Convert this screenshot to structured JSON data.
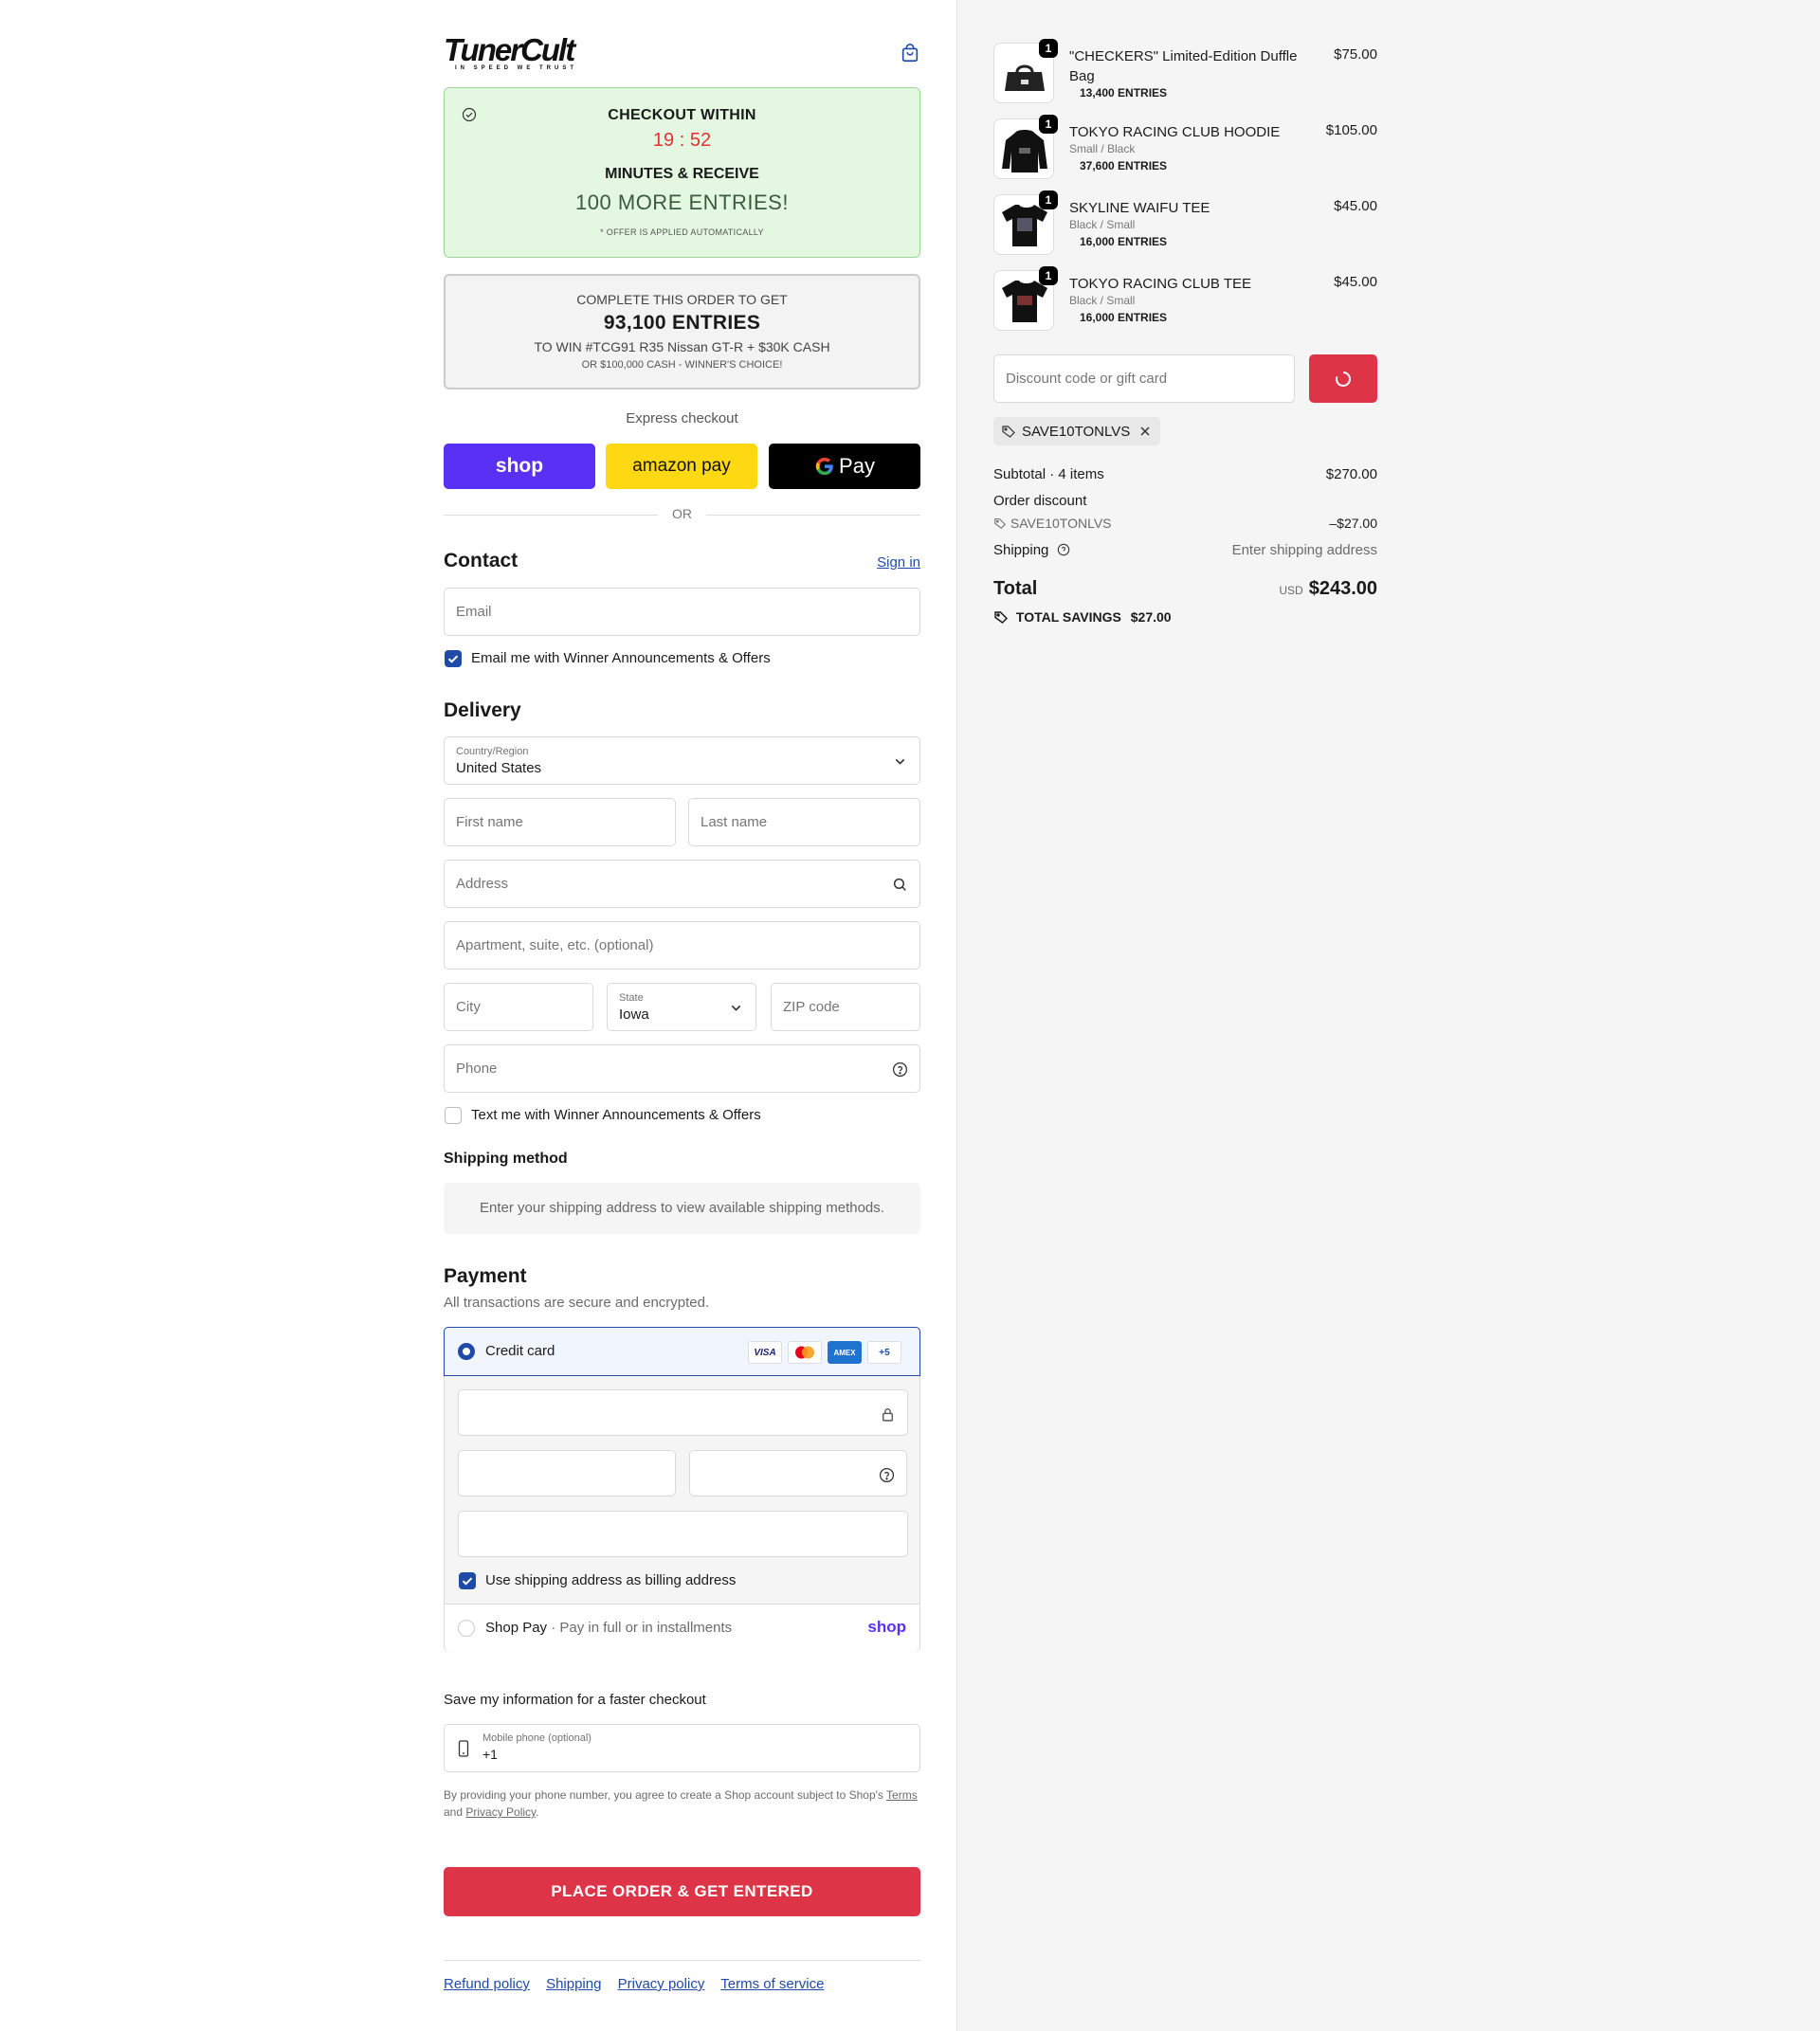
{
  "brand": {
    "name": "TunerCult",
    "tagline": "IN SPEED WE TRUST"
  },
  "promo": {
    "line1": "CHECKOUT WITHIN",
    "timer": "19 : 52",
    "line2": "MINUTES & RECEIVE",
    "line3": "100 MORE ENTRIES!",
    "note": "* OFFER IS APPLIED AUTOMATICALLY"
  },
  "entries_box": {
    "line1": "COMPLETE THIS ORDER TO GET",
    "line2": "93,100 ENTRIES",
    "line3": "TO WIN #TCG91 R35 Nissan GT-R + $30K CASH",
    "line4": "OR $100,000 CASH - WINNER'S CHOICE!"
  },
  "express": {
    "label": "Express checkout",
    "shop": "shop",
    "amazon": "amazon pay",
    "gpay": "Pay",
    "or": "OR"
  },
  "contact": {
    "title": "Contact",
    "sign_in": "Sign in",
    "email_placeholder": "Email",
    "email_optin": "Email me with Winner Announcements & Offers"
  },
  "delivery": {
    "title": "Delivery",
    "country_label": "Country/Region",
    "country_value": "United States",
    "first_name": "First name",
    "last_name": "Last name",
    "address": "Address",
    "apartment": "Apartment, suite, etc. (optional)",
    "city": "City",
    "state_label": "State",
    "state_value": "Iowa",
    "zip": "ZIP code",
    "phone": "Phone",
    "sms_optin": "Text me with Winner Announcements & Offers"
  },
  "shipping_method": {
    "title": "Shipping method",
    "info": "Enter your shipping address to view available shipping methods."
  },
  "payment": {
    "title": "Payment",
    "subtitle": "All transactions are secure and encrypted.",
    "credit_card": "Credit card",
    "card_more": "+5",
    "cards": [
      "VISA",
      "mastercard",
      "AMEX"
    ],
    "billing_same": "Use shipping address as billing address",
    "shop_pay": "Shop Pay",
    "shop_pay_desc": "· Pay in full or in installments",
    "shop_pay_logo": "shop"
  },
  "save_info": {
    "title": "Save my information for a faster checkout",
    "mobile_label": "Mobile phone (optional)",
    "mobile_value": "+1",
    "legal_prefix": "By providing your phone number, you agree to create a Shop account subject to Shop's",
    "terms": "Terms",
    "and": "and",
    "privacy": "Privacy Policy",
    "period": "."
  },
  "place_order": "PLACE ORDER & GET ENTERED",
  "footer_links": [
    "Refund policy",
    "Shipping",
    "Privacy policy",
    "Terms of service"
  ],
  "cart": {
    "items": [
      {
        "qty": "1",
        "name": "\"CHECKERS\" Limited-Edition Duffle Bag",
        "variant": "",
        "entries": "13,400 ENTRIES",
        "price": "$75.00"
      },
      {
        "qty": "1",
        "name": "TOKYO RACING CLUB HOODIE",
        "variant": "Small / Black",
        "entries": "37,600 ENTRIES",
        "price": "$105.00"
      },
      {
        "qty": "1",
        "name": "SKYLINE WAIFU TEE",
        "variant": "Black / Small",
        "entries": "16,000 ENTRIES",
        "price": "$45.00"
      },
      {
        "qty": "1",
        "name": "TOKYO RACING CLUB TEE",
        "variant": "Black / Small",
        "entries": "16,000 ENTRIES",
        "price": "$45.00"
      }
    ],
    "discount_placeholder": "Discount code or gift card",
    "applied_code": "SAVE10TONLVS",
    "subtotal_label": "Subtotal · 4 items",
    "subtotal": "$270.00",
    "order_discount_label": "Order discount",
    "discount_code": "SAVE10TONLVS",
    "discount_value": "–$27.00",
    "shipping_label": "Shipping",
    "shipping_value": "Enter shipping address",
    "total_label": "Total",
    "currency": "USD",
    "total": "$243.00",
    "savings_label": "TOTAL SAVINGS",
    "savings": "$27.00"
  },
  "colors": {
    "accent": "#1f4aa8",
    "cta": "#dd3547",
    "shop": "#5a31f4",
    "amazon": "#ffd814",
    "promo_bg": "#e3f7e1",
    "timer": "#dd3333"
  }
}
